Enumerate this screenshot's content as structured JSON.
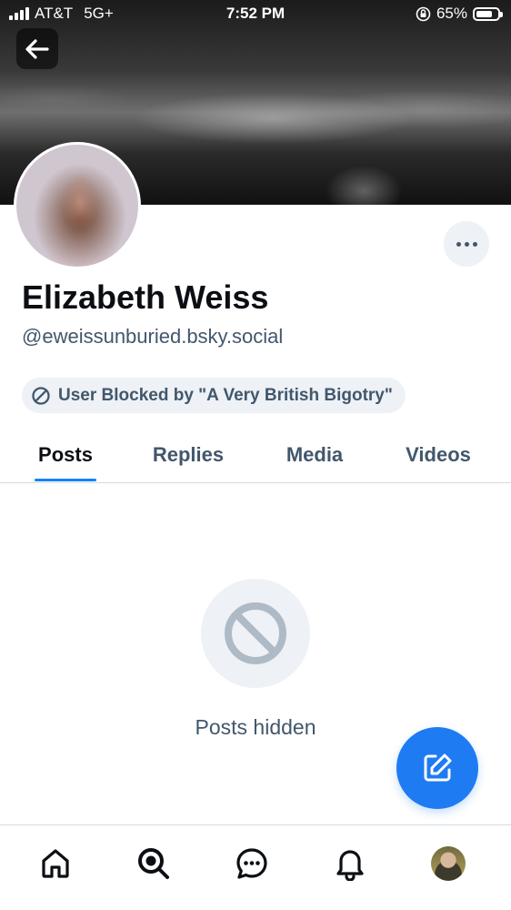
{
  "status_bar": {
    "carrier": "AT&T",
    "network": "5G+",
    "time": "7:52 PM",
    "battery_percent": "65%",
    "battery_level": 0.65
  },
  "header": {
    "back_icon": "arrow-left-icon",
    "more_icon": "ellipsis-icon"
  },
  "profile": {
    "display_name": "Elizabeth Weiss",
    "handle": "@eweissunburied.bsky.social",
    "blocked_label": "User Blocked by \"A Very British Bigotry\"",
    "blocked_icon": "block-icon"
  },
  "tabs": [
    {
      "label": "Posts",
      "active": true
    },
    {
      "label": "Replies",
      "active": false
    },
    {
      "label": "Media",
      "active": false
    },
    {
      "label": "Videos",
      "active": false
    }
  ],
  "empty_state": {
    "icon": "block-icon",
    "message": "Posts hidden"
  },
  "compose_fab": {
    "icon": "compose-icon"
  },
  "bottom_nav": [
    {
      "icon": "home-icon"
    },
    {
      "icon": "search-icon"
    },
    {
      "icon": "chat-icon"
    },
    {
      "icon": "bell-icon"
    },
    {
      "icon": "profile-avatar"
    }
  ],
  "colors": {
    "accent": "#1083fe",
    "fab": "#1f7bf2",
    "muted_text": "#42576c",
    "pill_bg": "#eef1f5"
  }
}
